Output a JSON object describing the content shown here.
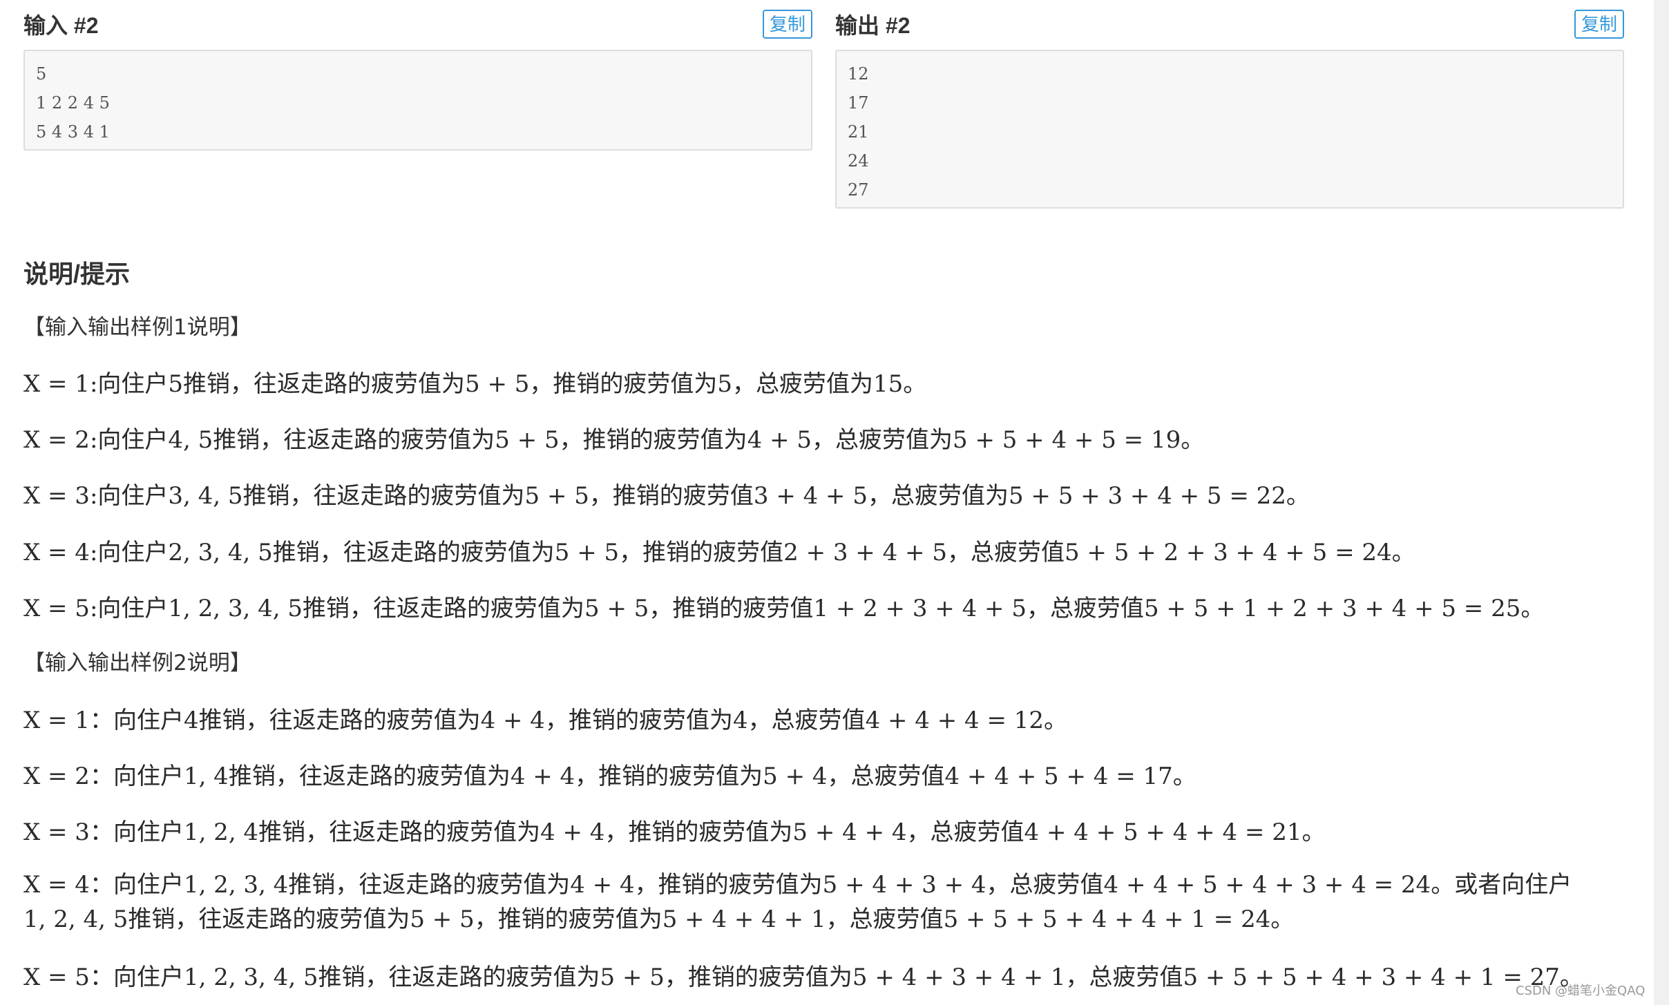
{
  "samples": {
    "input": {
      "title": "输入 #2",
      "copy_label": "复制",
      "lines": [
        "5",
        "1 2 2 4 5",
        "5 4 3 4 1"
      ]
    },
    "output": {
      "title": "输出 #2",
      "copy_label": "复制",
      "lines": [
        "12",
        "17",
        "21",
        "24",
        "27"
      ]
    }
  },
  "notes": {
    "title": "说明/提示",
    "sample1_header": "【输入输出样例1说明】",
    "sample1_lines": [
      "X = 1:向住户5推销，往返走路的疲劳值为5 + 5，推销的疲劳值为5，总疲劳值为15。",
      "X = 2:向住户4, 5推销，往返走路的疲劳值为5 + 5，推销的疲劳值为4 + 5，总疲劳值为5 + 5 + 4 + 5 = 19。",
      "X = 3:向住户3, 4, 5推销，往返走路的疲劳值为5 + 5，推销的疲劳值3 + 4 + 5，总疲劳值为5 + 5 + 3 + 4 + 5 = 22。",
      "X = 4:向住户2, 3, 4, 5推销，往返走路的疲劳值为5 + 5，推销的疲劳值2 + 3 + 4 + 5，总疲劳值5 + 5 + 2 + 3 + 4 + 5 = 24。",
      "X = 5:向住户1, 2, 3, 4, 5推销，往返走路的疲劳值为5 + 5，推销的疲劳值1 + 2 + 3 + 4 + 5，总疲劳值5 + 5 + 1 + 2 + 3 + 4 + 5 = 25。"
    ],
    "sample2_header": "【输入输出样例2说明】",
    "sample2_lines": [
      "X = 1：向住户4推销，往返走路的疲劳值为4 + 4，推销的疲劳值为4，总疲劳值4 + 4 + 4 = 12。",
      "X = 2：向住户1, 4推销，往返走路的疲劳值为4 + 4，推销的疲劳值为5 + 4，总疲劳值4 + 4 + 5 + 4 = 17。",
      "X = 3：向住户1, 2, 4推销，往返走路的疲劳值为4 + 4，推销的疲劳值为5 + 4 + 4，总疲劳值4 + 4 + 5 + 4 + 4 = 21。",
      "X = 4：向住户1, 2, 3, 4推销，往返走路的疲劳值为4 + 4，推销的疲劳值为5 + 4 + 3 + 4，总疲劳值4 + 4 + 5 + 4 + 3 + 4 = 24。或者向住户1, 2, 4, 5推销，往返走路的疲劳值为5 + 5，推销的疲劳值为5 + 4 + 4 + 1，总疲劳值5 + 5 + 5 + 4 + 4 + 1 = 24。",
      "X = 5：向住户1, 2, 3, 4, 5推销，往返走路的疲劳值为5 + 5，推销的疲劳值为5 + 4 + 3 + 4 + 1，总疲劳值5 + 5 + 5 + 4 + 3 + 4 + 1 = 27。"
    ]
  },
  "watermark": "CSDN @蜡笔小金QAQ",
  "colors": {
    "accent": "#3498db",
    "code_bg": "#f7f7f7",
    "code_border": "#dddddd",
    "text": "#333333"
  }
}
